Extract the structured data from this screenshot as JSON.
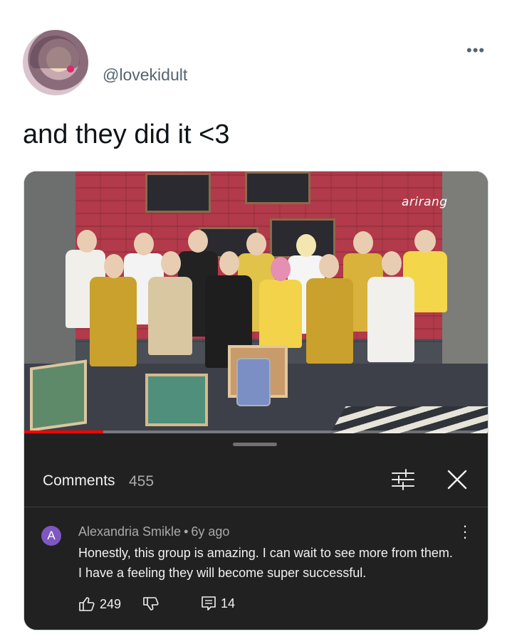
{
  "tweet": {
    "handle": "@lovekidult",
    "text": "and they did it <3",
    "more_icon": "more-horizontal-icon"
  },
  "video": {
    "channel_logo": "arirang",
    "progress": 0.17,
    "colors": {
      "progress": "#ff0000",
      "wall": "#b23a4a"
    }
  },
  "comments": {
    "title": "Comments",
    "count": "455",
    "filter_icon": "filter-sliders-icon",
    "close_icon": "close-icon",
    "items": [
      {
        "avatar_letter": "A",
        "author": "Alexandria Smikle",
        "separator": "•",
        "age": "6y ago",
        "body": "Honestly, this group is amazing. I can wait to see more from them. I have a feeling they will become super successful.",
        "likes": "249",
        "replies": "14",
        "avatar_color": "#7e57c2"
      }
    ]
  }
}
